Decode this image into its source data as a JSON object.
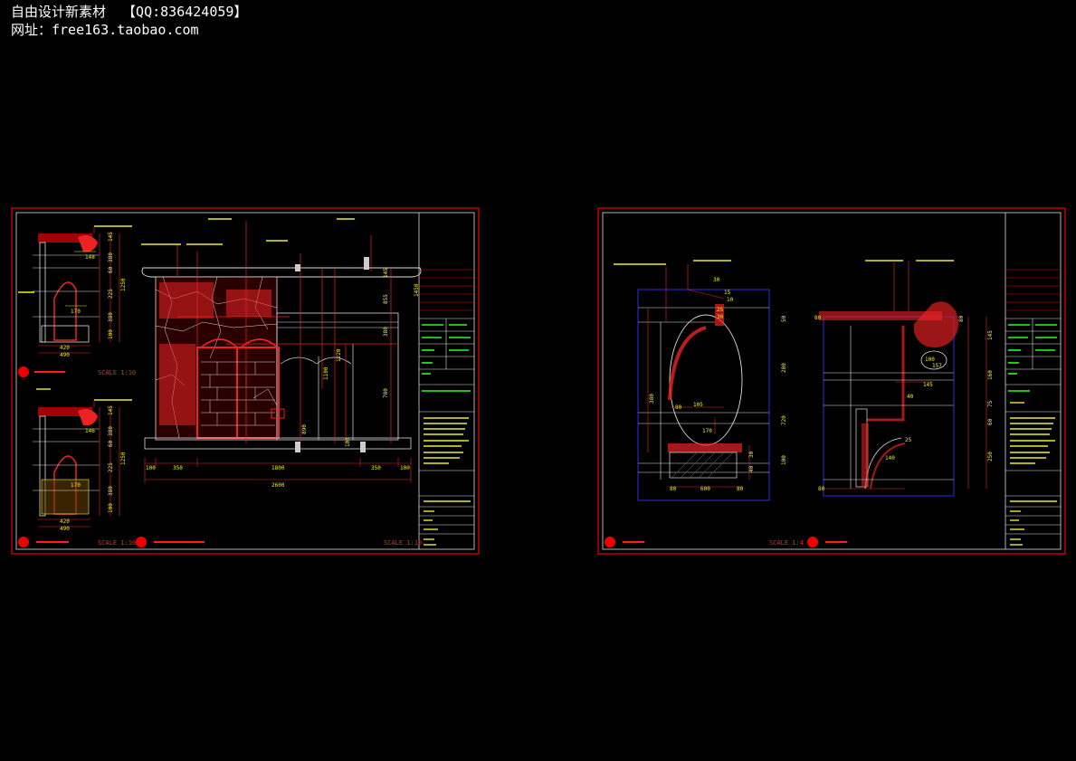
{
  "watermark": {
    "line1": "自由设计新素材  【QQ:836424059】",
    "line2": "网址：free163.taobao.com"
  },
  "sheet_left": {
    "scale_a": "SCALE 1:10",
    "scale_b": "SCALE 1:10",
    "scale_c": "SCALE 1:10",
    "section_dims_top": [
      "145",
      "380",
      "60",
      "225",
      "380",
      "100",
      "1250",
      "148",
      "170",
      "420",
      "490"
    ],
    "section_dims_bottom": [
      "145",
      "380",
      "60",
      "225",
      "380",
      "100",
      "1250",
      "146",
      "170",
      "420",
      "490"
    ],
    "elev_dims_bottom": [
      "100",
      "350",
      "1800",
      "350",
      "100",
      "2600"
    ],
    "elev_dims_right": [
      "145",
      "855",
      "380",
      "780",
      "1450",
      "1220",
      "1100",
      "890",
      "100"
    ]
  },
  "sheet_right": {
    "scale_a": "SCALE 1:4",
    "dims_a": [
      "30",
      "15",
      "10",
      "25",
      "30",
      "105",
      "80",
      "170",
      "380",
      "80",
      "600",
      "80",
      "50",
      "280",
      "720",
      "100",
      "40",
      "30"
    ],
    "dims_b": [
      "80",
      "100",
      "157",
      "145",
      "40",
      "25",
      "140",
      "80",
      "80",
      "145",
      "160",
      "75",
      "60",
      "250"
    ]
  }
}
